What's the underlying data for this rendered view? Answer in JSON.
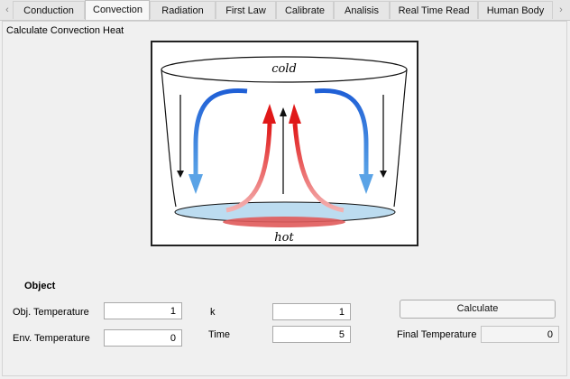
{
  "tabs": [
    {
      "label": "Conduction",
      "active": false
    },
    {
      "label": "Convection",
      "active": true
    },
    {
      "label": "Radiation",
      "active": false
    },
    {
      "label": "First Law",
      "active": false
    },
    {
      "label": "Calibrate",
      "active": false
    },
    {
      "label": "Analisis",
      "active": false
    },
    {
      "label": "Real Time Read",
      "active": false
    },
    {
      "label": "Human Body",
      "active": false
    }
  ],
  "tab_scroll": {
    "left_icon": "chevron-left-icon",
    "right_icon": "chevron-right-icon"
  },
  "panel_title": "Calculate Convection Heat",
  "illustration": {
    "top_label": "cold",
    "bottom_label": "hot",
    "colors": {
      "cold_arrow": "#1f5fd6",
      "hot_arrow": "#e02020",
      "liquid": "#bcdcf0",
      "heater": "#e05a5a"
    }
  },
  "form": {
    "section_title": "Object",
    "obj_temperature": {
      "label": "Obj. Temperature",
      "value": "1"
    },
    "env_temperature": {
      "label": "Env. Temperature",
      "value": "0"
    },
    "k": {
      "label": "k",
      "value": "1"
    },
    "time": {
      "label": "Time",
      "value": "5"
    },
    "calculate_label": "Calculate",
    "final_temperature": {
      "label": "Final Temperature",
      "value": "0"
    }
  }
}
